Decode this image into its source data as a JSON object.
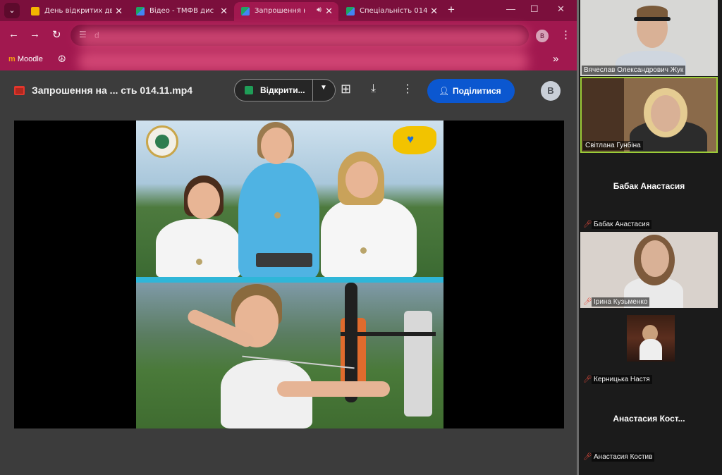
{
  "browser": {
    "tabs": [
      {
        "label": "День відкритих дв",
        "favicon_color": "#f4b400"
      },
      {
        "label": "Відео - ТМФВ дис",
        "favicon_color": "#1fa463"
      },
      {
        "label": "Запрошення н",
        "favicon_color": "#1fa463",
        "active": true,
        "audio_icon": "speaker-icon"
      },
      {
        "label": "Спеціальність 014",
        "favicon_color": "#1fa463"
      }
    ],
    "url_fragment": "d",
    "profile_initial": "B",
    "bookmarks": [
      {
        "label": "Moodle",
        "icon": "moodle-icon"
      },
      {
        "label": "",
        "icon": "peace-icon"
      }
    ],
    "theme_color": "#a1184f"
  },
  "viewer": {
    "file_name": "Запрошення на ... сть 014.11.mp4",
    "open_with_label": "Відкрити...",
    "share_label": "Поділитися",
    "account_initial": "B",
    "share_color": "#0b57d0"
  },
  "meeting": {
    "participants": [
      {
        "name": "Вячеслав Олександрович Жук",
        "video": true,
        "muted": false
      },
      {
        "name": "Світлана Гунбіна",
        "video": true,
        "muted": false,
        "selected": true
      },
      {
        "name": "Бабак Анастасия",
        "video": false,
        "muted": true,
        "display_name": "Бабак Анастасия"
      },
      {
        "name": "Ірина Кузьменко",
        "video": true,
        "muted": true
      },
      {
        "name": "Керницька Настя",
        "video": false,
        "muted": true,
        "avatar": true
      },
      {
        "name": "Анастасия Костив",
        "video": false,
        "muted": true,
        "display_name": "Анастасия  Кост..."
      }
    ],
    "active_speaker_color": "#9ccc38",
    "muted_color": "#e64a3b"
  }
}
